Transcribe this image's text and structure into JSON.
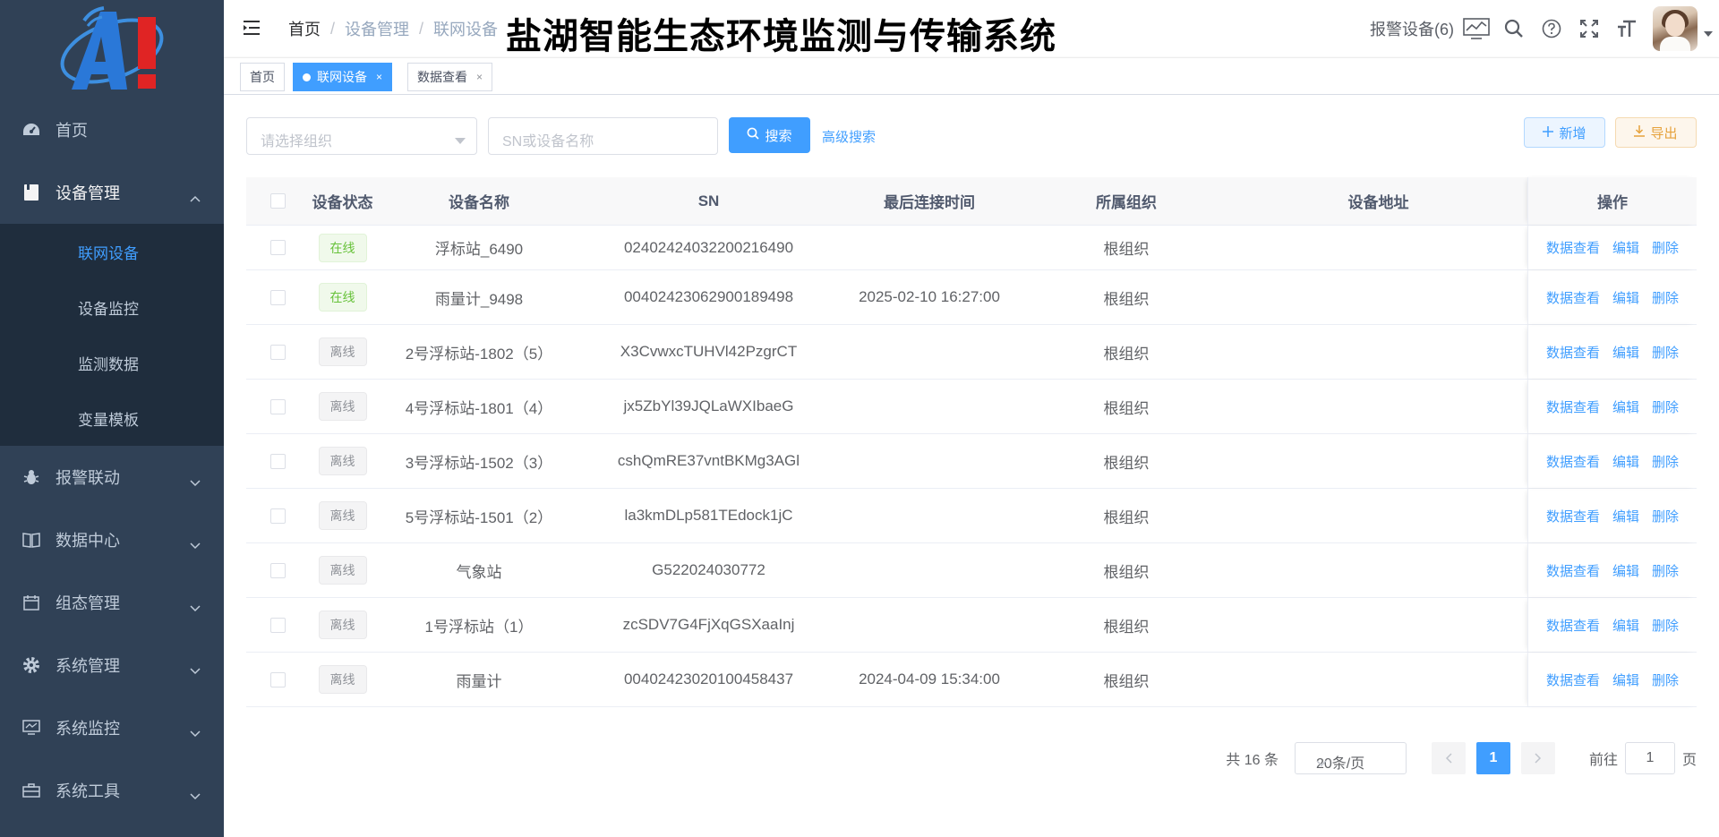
{
  "sidebar": {
    "items": [
      {
        "label": "首页",
        "icon": "dashboard-icon"
      },
      {
        "label": "设备管理",
        "icon": "device-icon",
        "open": true,
        "children": [
          {
            "label": "联网设备",
            "active": true
          },
          {
            "label": "设备监控"
          },
          {
            "label": "监测数据"
          },
          {
            "label": "变量模板"
          }
        ]
      },
      {
        "label": "报警联动",
        "icon": "bug-icon"
      },
      {
        "label": "数据中心",
        "icon": "book-icon"
      },
      {
        "label": "组态管理",
        "icon": "calendar-icon"
      },
      {
        "label": "系统管理",
        "icon": "gear-icon"
      },
      {
        "label": "系统监控",
        "icon": "monitor-icon"
      },
      {
        "label": "系统工具",
        "icon": "toolbox-icon"
      }
    ]
  },
  "header": {
    "breadcrumb": [
      "首页",
      "设备管理",
      "联网设备"
    ],
    "system_title": "盐湖智能生态环境监测与传输系统",
    "alarm_label": "报警设备(6)"
  },
  "tags": [
    {
      "label": "首页"
    },
    {
      "label": "联网设备",
      "active": true,
      "close": "×"
    },
    {
      "label": "数据查看",
      "close": "×"
    }
  ],
  "filters": {
    "org_placeholder": "请选择组织",
    "sn_placeholder": "SN或设备名称",
    "search_label": "搜索",
    "advanced_label": "高级搜索",
    "add_label": "新增",
    "export_label": "导出"
  },
  "table": {
    "columns": {
      "status": "设备状态",
      "name": "设备名称",
      "sn": "SN",
      "last_time": "最后连接时间",
      "org": "所属组织",
      "address": "设备地址",
      "ops": "操作"
    },
    "op_labels": {
      "view": "数据查看",
      "edit": "编辑",
      "delete": "删除"
    },
    "rows": [
      {
        "status": "在线",
        "online": true,
        "name": "浮标站_6490",
        "sn": "02402424032200216490",
        "time": "",
        "org": "根组织",
        "address": ""
      },
      {
        "status": "在线",
        "online": true,
        "name": "雨量计_9498",
        "sn": "00402423062900189498",
        "time": "2025-02-10 16:27:00",
        "org": "根组织",
        "address": ""
      },
      {
        "status": "离线",
        "online": false,
        "name": "2号浮标站-1802（5）",
        "sn": "X3CvwxcTUHVl42PzgrCT",
        "time": "",
        "org": "根组织",
        "address": ""
      },
      {
        "status": "离线",
        "online": false,
        "name": "4号浮标站-1801（4）",
        "sn": "jx5ZbYl39JQLaWXIbaeG",
        "time": "",
        "org": "根组织",
        "address": ""
      },
      {
        "status": "离线",
        "online": false,
        "name": "3号浮标站-1502（3）",
        "sn": "cshQmRE37vntBKMg3AGl",
        "time": "",
        "org": "根组织",
        "address": ""
      },
      {
        "status": "离线",
        "online": false,
        "name": "5号浮标站-1501（2）",
        "sn": "la3kmDLp581TEdock1jC",
        "time": "",
        "org": "根组织",
        "address": ""
      },
      {
        "status": "离线",
        "online": false,
        "name": "气象站",
        "sn": "G522024030772",
        "time": "",
        "org": "根组织",
        "address": ""
      },
      {
        "status": "离线",
        "online": false,
        "name": "1号浮标站（1）",
        "sn": "zcSDV7G4FjXqGSXaaInj",
        "time": "",
        "org": "根组织",
        "address": ""
      },
      {
        "status": "离线",
        "online": false,
        "name": "雨量计",
        "sn": "00402423020100458437",
        "time": "2024-04-09 15:34:00",
        "org": "根组织",
        "address": ""
      }
    ]
  },
  "pagination": {
    "total_label": "共 16 条",
    "page_size_label": "20条/页",
    "current_page": "1",
    "goto_label": "前往",
    "goto_value": "1",
    "page_suffix": "页"
  },
  "colors": {
    "sidebar_bg": "#304156",
    "submenu_bg": "#1f2d3d",
    "primary": "#409eff",
    "success": "#67c23a",
    "warning": "#e6a23c",
    "info": "#909399"
  }
}
